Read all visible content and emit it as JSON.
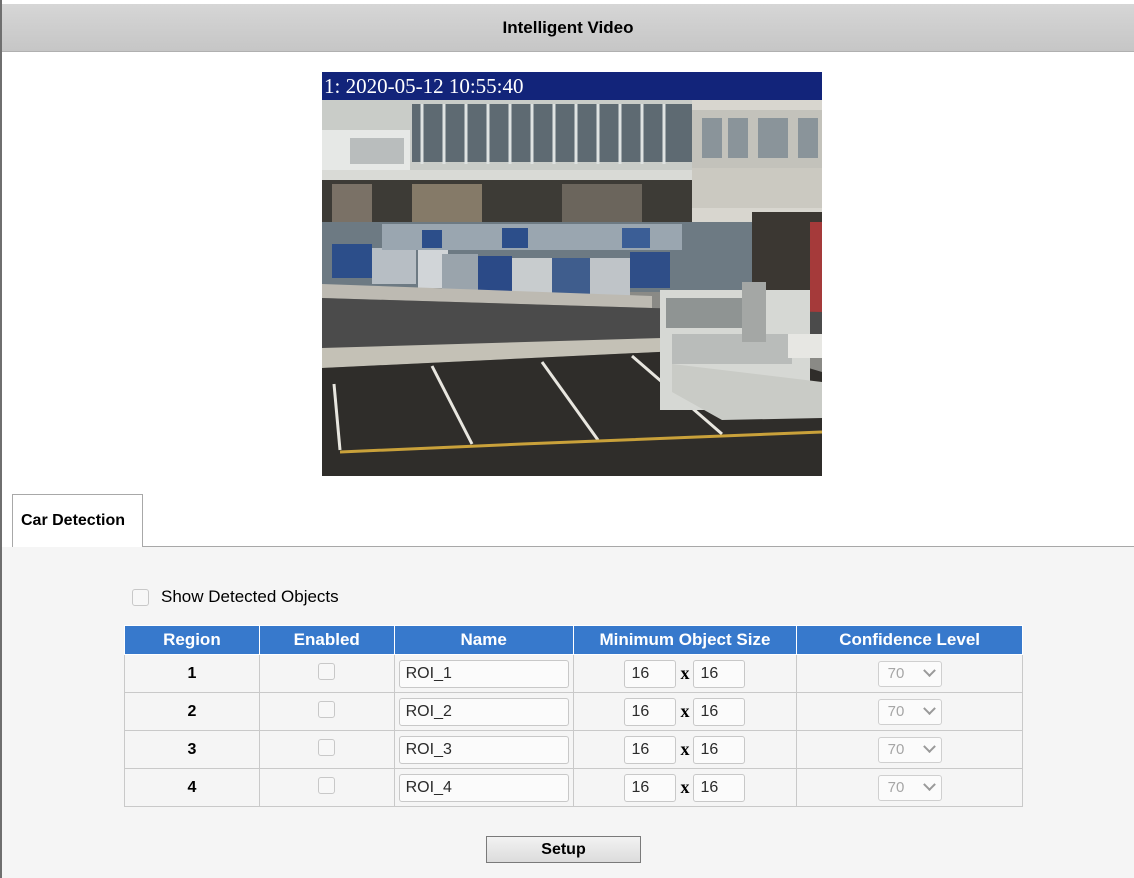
{
  "page": {
    "title": "Intelligent Video"
  },
  "video": {
    "osd_text": "1: 2020-05-12 10:55:40"
  },
  "tabs": [
    {
      "label": "Car Detection",
      "active": true
    }
  ],
  "show_detected_objects": {
    "label": "Show Detected Objects",
    "checked": false
  },
  "table": {
    "headers": [
      "Region",
      "Enabled",
      "Name",
      "Minimum Object Size",
      "Confidence Level"
    ],
    "separator": "x",
    "rows": [
      {
        "region": "1",
        "enabled": false,
        "name": "ROI_1",
        "min_w": "16",
        "min_h": "16",
        "confidence": "70"
      },
      {
        "region": "2",
        "enabled": false,
        "name": "ROI_2",
        "min_w": "16",
        "min_h": "16",
        "confidence": "70"
      },
      {
        "region": "3",
        "enabled": false,
        "name": "ROI_3",
        "min_w": "16",
        "min_h": "16",
        "confidence": "70"
      },
      {
        "region": "4",
        "enabled": false,
        "name": "ROI_4",
        "min_w": "16",
        "min_h": "16",
        "confidence": "70"
      }
    ]
  },
  "buttons": {
    "setup_label": "Setup"
  },
  "colors": {
    "header_bg": "#3779cc",
    "osd_bg": "#12247a",
    "titlebar_bg": "#cccccc"
  }
}
